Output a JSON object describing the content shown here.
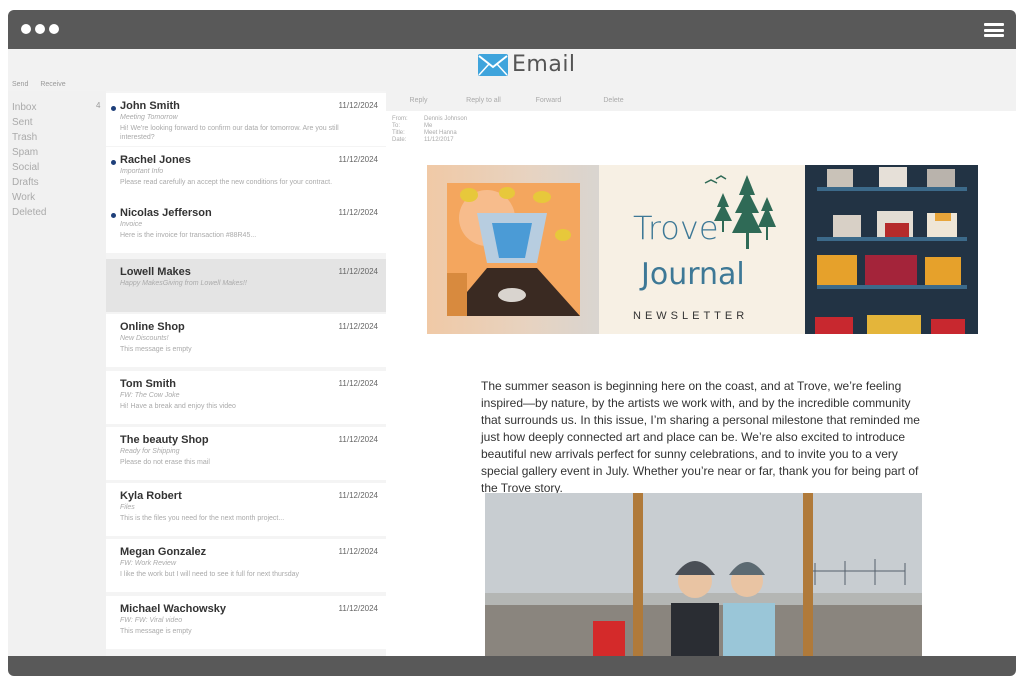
{
  "app": {
    "logo_text": "Email"
  },
  "toolbar_left": {
    "send": "Send",
    "receive": "Receive"
  },
  "folders": {
    "inbox_count": "4",
    "items": [
      "Inbox",
      "Sent",
      "Trash",
      "Spam",
      "Social",
      "Drafts",
      "Work",
      "Deleted"
    ]
  },
  "messages": [
    {
      "sender": "John Smith",
      "date": "11/12/2024",
      "subject": "Meeting Tomorrow",
      "preview": "Hi! We're looking forward to confirm our data for tomorrow. Are you still interested?",
      "unread": true
    },
    {
      "sender": "Rachel Jones",
      "date": "11/12/2024",
      "subject": "Important Info",
      "preview": "Please read carefully an accept the new conditions for your contract.",
      "unread": true
    },
    {
      "sender": "Nicolas Jefferson",
      "date": "11/12/2024",
      "subject": "Invoice",
      "preview": "Here is the invoice for transaction #88R45...",
      "unread": true
    },
    {
      "sender": "Lowell Makes",
      "date": "11/12/2024",
      "subject": "Happy MakesGiving from Lowell Makes!!",
      "preview": "",
      "unread": false,
      "selected": true
    },
    {
      "sender": "Online Shop",
      "date": "11/12/2024",
      "subject": "New Discounts!",
      "preview": "This message is empty",
      "unread": false
    },
    {
      "sender": "Tom Smith",
      "date": "11/12/2024",
      "subject": "FW: The Cow Joke",
      "preview": "Hi! Have a break and enjoy this video",
      "unread": false
    },
    {
      "sender": "The beauty Shop",
      "date": "11/12/2024",
      "subject": "Ready for Shipping",
      "preview": "Please do not erase this mail",
      "unread": false
    },
    {
      "sender": "Kyla Robert",
      "date": "11/12/2024",
      "subject": "Files",
      "preview": "This is the files you need for the next month project...",
      "unread": false
    },
    {
      "sender": "Megan Gonzalez",
      "date": "11/12/2024",
      "subject": "FW: Work Review",
      "preview": "I like the work but I will need to see it full for next thursday",
      "unread": false
    },
    {
      "sender": "Michael Wachowsky",
      "date": "11/12/2024",
      "subject": "FW: FW: Viral video",
      "preview": "This message is empty",
      "unread": false
    }
  ],
  "reader": {
    "toolbar": [
      "Reply",
      "Reply to all",
      "Forward",
      "Delete"
    ],
    "meta": {
      "from_label": "From:",
      "from": "Dennis Johnson",
      "to_label": "To:",
      "to": "Me",
      "title_label": "Title:",
      "title": "Meet Hanna",
      "date_label": "Date:",
      "date": "11/12/2017"
    },
    "banner": {
      "trove": "Trove",
      "journal": "Journal",
      "newsletter": "NEWSLETTER"
    },
    "body": "The summer season is beginning here on the coast, and at Trove, we’re feeling inspired—by nature, by the artists we work with, and by the incredible community that surrounds us. In this issue, I’m sharing a personal milestone that reminded me just how deeply connected art and place can be. We’re also excited to introduce beautiful new arrivals perfect for sunny celebrations, and to invite you to a very special gallery event in July. Whether you’re near or far, thank you for being part of the Trove story."
  },
  "colors": {
    "chrome": "#595959",
    "unread_dot": "#1e3f7a",
    "logo_blue": "#3fa4dc",
    "trove_teal": "#3d7896"
  }
}
